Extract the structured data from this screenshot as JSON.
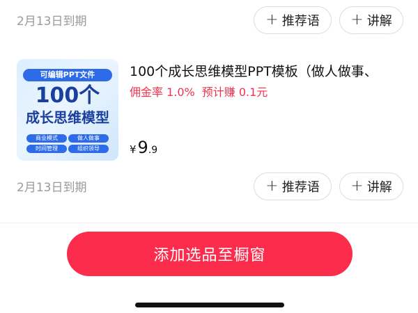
{
  "rows": [
    {
      "expire": "2月13日到期",
      "recommend_label": "推荐语",
      "explain_label": "讲解"
    },
    {
      "expire": "2月13日到期",
      "recommend_label": "推荐语",
      "explain_label": "讲解"
    }
  ],
  "product": {
    "title": "100个成长思维模型PPT模板（做人做事、",
    "commission": "佣金率 1.0%",
    "estimate": "预计赚 0.1元",
    "price_currency": "¥",
    "price_int": "9",
    "price_dec": ".9",
    "thumb": {
      "banner": "可编辑PPT文件",
      "big": "100个",
      "mid": "成长思维模型",
      "tags": [
        "商业模式",
        "做人做事",
        "时间管理",
        "组织领导"
      ]
    }
  },
  "icons": {
    "plus": "plus-icon"
  },
  "cta": {
    "label": "添加选品至橱窗"
  },
  "colors": {
    "accent": "#fb2c4c",
    "commission": "#f2314d",
    "muted": "#9a9a9a",
    "thumb_blue": "#2d6be8"
  }
}
